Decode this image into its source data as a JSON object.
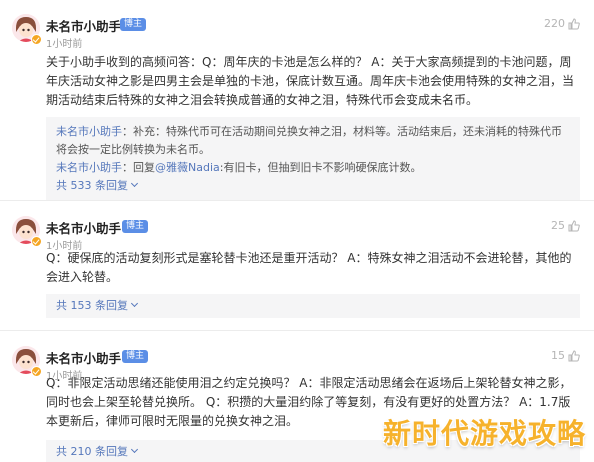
{
  "colors": {
    "accent_link": "#5577bb",
    "badge": "#5b8ee6",
    "watermark": "#f6b22c",
    "verify": "#f5a623"
  },
  "icons": {
    "avatar": "anime-avatar-icon",
    "like": "thumbs-up-icon",
    "verify": "verified-icon"
  },
  "posts": [
    {
      "author": "未名市小助手",
      "badge": "博主",
      "time": "1小时前",
      "likes": "220",
      "content": "关于小助手收到的高频问答：Q：周年庆的卡池是怎么样的？ A：关于大家高频提到的卡池问题，周年庆活动女神之影是四男主会是单独的卡池，保底计数互通。周年庆卡池会使用特殊的女神之泪，当期活动结束后特殊的女神之泪会转换成普通的女神之泪，特殊代币会变成未名币。",
      "replies": [
        {
          "author": "未名市小助手",
          "badge": "博主",
          "text": "：补充：特殊代币可在活动期间兑换女神之泪，材料等。活动结束后，还未消耗的特殊代币将会按一定比例转换为未名币。"
        },
        {
          "author": "未名市小助手",
          "badge": "博主",
          "text_before": "：回复",
          "mention": "@雅薇Nadia",
          "text_after": ":有旧卡，但抽到旧卡不影响硬保底计数。"
        }
      ],
      "more": "共 533 条回复"
    },
    {
      "author": "未名市小助手",
      "badge": "博主",
      "time": "1小时前",
      "likes": "25",
      "content": "Q：硬保底的活动复刻形式是塞轮替卡池还是重开活动？ A：特殊女神之泪活动不会进轮替，其他的会进入轮替。",
      "more": "共 153 条回复"
    },
    {
      "author": "未名市小助手",
      "badge": "博主",
      "time": "1小时前",
      "likes": "15",
      "content": "Q：非限定活动思绪还能使用泪之约定兑换吗？ A：非限定活动思绪会在返场后上架轮替女神之影，同时也会上架至轮替兑换所。 Q：积攒的大量泪约除了等复刻，有没有更好的处置方法？ A：1.7版本更新后，律师可限时无限量的兑换女神之泪。",
      "more": "共 210 条回复"
    }
  ],
  "watermark": "新时代游戏攻略"
}
